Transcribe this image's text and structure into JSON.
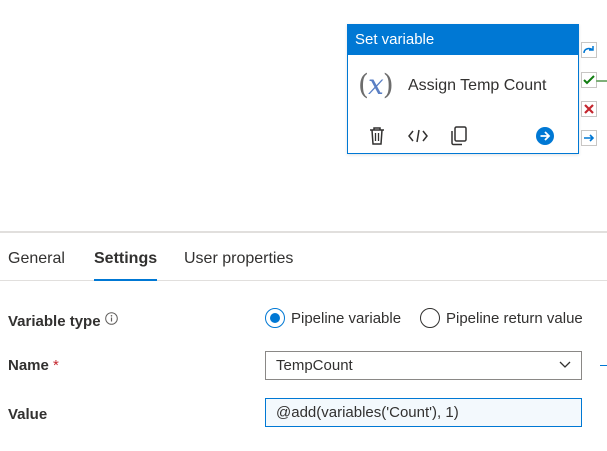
{
  "activity": {
    "header": "Set variable",
    "title": "Assign Temp Count",
    "icon": "variable-fx-icon",
    "actions": [
      "delete-icon",
      "code-icon",
      "copy-icon",
      "go-arrow-icon"
    ],
    "ports": [
      "skip-icon",
      "success-check-icon",
      "failure-x-icon",
      "completion-arrow-icon"
    ]
  },
  "tabs": [
    {
      "label": "General"
    },
    {
      "label": "Settings",
      "active": true
    },
    {
      "label": "User properties"
    }
  ],
  "form": {
    "variable_type": {
      "label": "Variable type",
      "options": [
        {
          "label": "Pipeline variable",
          "selected": true
        },
        {
          "label": "Pipeline return value",
          "selected": false
        }
      ]
    },
    "name": {
      "label": "Name",
      "required_mark": "*",
      "value": "TempCount"
    },
    "value": {
      "label": "Value",
      "value": "@add(variables('Count'), 1)"
    }
  },
  "colors": {
    "accent": "#0078d4",
    "failure": "#c4262e",
    "success": "#107c10"
  }
}
